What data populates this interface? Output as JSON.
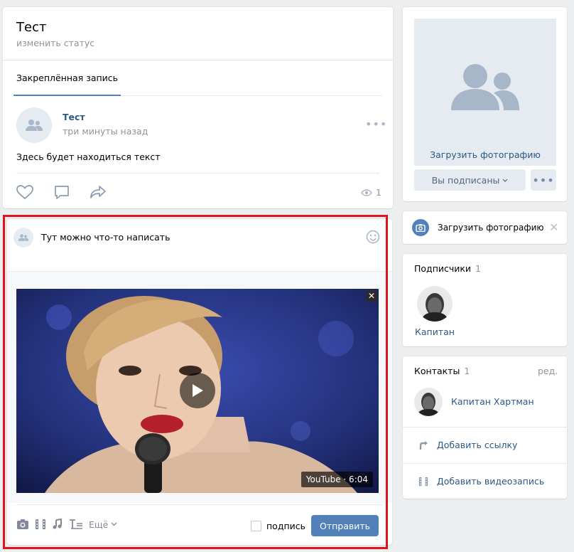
{
  "profile": {
    "name": "Тест",
    "status_placeholder": "изменить статус"
  },
  "wall": {
    "tab_label": "Закреплённая запись",
    "post": {
      "author": "Тест",
      "time": "три минуты назад",
      "text": "Здесь будет находиться текст",
      "views": "1"
    }
  },
  "composer": {
    "input_text": "Тут можно что-то написать",
    "video_badge": "YouTube · 6:04",
    "more_label": "Ещё",
    "signature_label": "подпись",
    "send_label": "Отправить",
    "close_glyph": "✕"
  },
  "sidebar": {
    "upload_photo_label": "Загрузить фотографию",
    "subscribed_label": "Вы подписаны",
    "upload_banner_label": "Загрузить фотографию",
    "subscribers": {
      "title": "Подписчики",
      "count": "1",
      "items": [
        {
          "name": "Капитан"
        }
      ]
    },
    "contacts": {
      "title": "Контакты",
      "count": "1",
      "edit_label": "ред.",
      "items": [
        {
          "name": "Капитан Хартман"
        }
      ],
      "add_link_label": "Добавить ссылку",
      "add_video_label": "Добавить видеозапись"
    }
  },
  "colors": {
    "accent": "#5181b8",
    "link": "#2a5885",
    "highlight_frame": "#e0141e"
  }
}
